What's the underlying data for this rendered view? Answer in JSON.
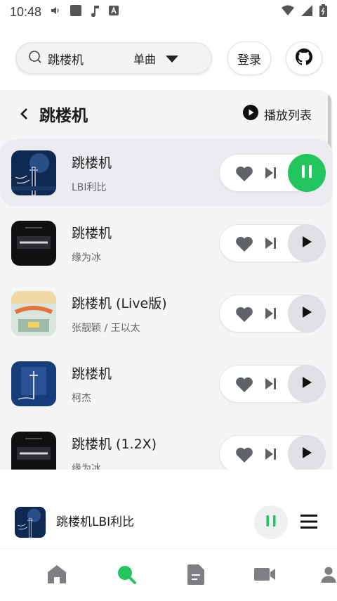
{
  "status_bar": {
    "time": "10:48"
  },
  "search": {
    "query": "跳楼机",
    "type": "单曲"
  },
  "header": {
    "login_label": "登录"
  },
  "panel": {
    "title": "跳楼机",
    "playlist_label": "播放列表"
  },
  "songs": [
    {
      "title": "跳楼机",
      "artist": "LBI利比",
      "playing": true
    },
    {
      "title": "跳楼机",
      "artist": "缘为冰",
      "playing": false
    },
    {
      "title": "跳楼机 (Live版)",
      "artist": "张靓颖 / 王以太",
      "playing": false
    },
    {
      "title": "跳楼机",
      "artist": "柯杰",
      "playing": false
    },
    {
      "title": "跳楼机 (1.2X)",
      "artist": "缘为冰",
      "playing": false
    }
  ],
  "now_playing": {
    "text": "跳楼机LBI利比"
  },
  "bottom_nav": [
    "home-icon",
    "search-icon",
    "document-icon",
    "video-icon",
    "user-icon"
  ],
  "colors": {
    "accent": "#22c55e",
    "inactive_icon": "#7d7f83"
  }
}
